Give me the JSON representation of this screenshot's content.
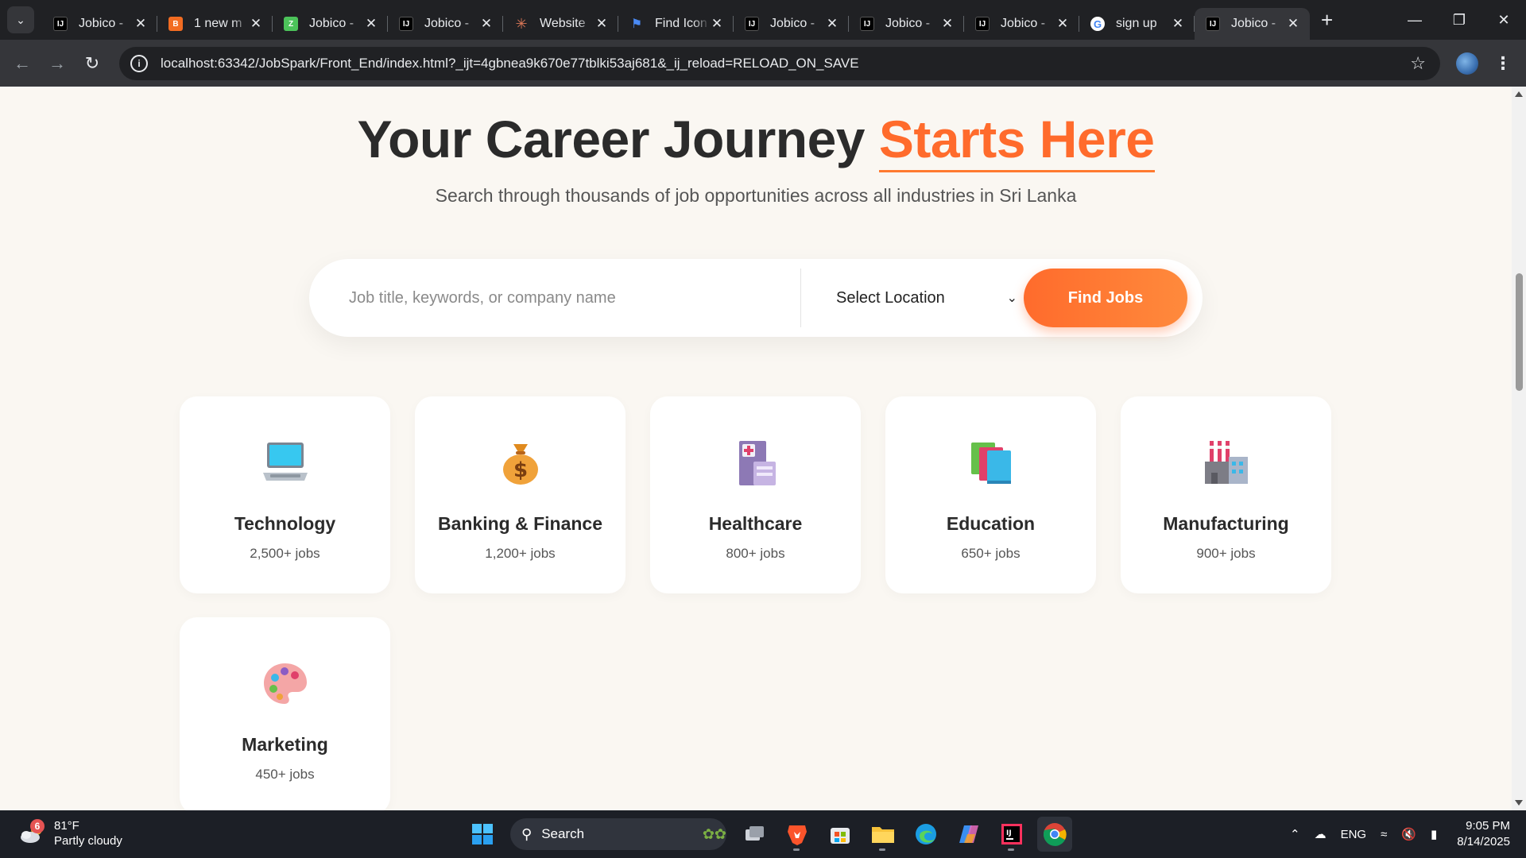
{
  "browser": {
    "tabs": [
      {
        "title": "Jobico -",
        "icon": "intellij-icon",
        "active": false
      },
      {
        "title": "1 new m",
        "icon": "blogger-icon",
        "active": false
      },
      {
        "title": "Jobico -",
        "icon": "green-app-icon",
        "active": false
      },
      {
        "title": "Jobico -",
        "icon": "intellij-icon",
        "active": false
      },
      {
        "title": "Website",
        "icon": "claude-icon",
        "active": false
      },
      {
        "title": "Find Icon",
        "icon": "flag-icon",
        "active": false
      },
      {
        "title": "Jobico -",
        "icon": "intellij-icon",
        "active": false
      },
      {
        "title": "Jobico -",
        "icon": "intellij-icon",
        "active": false
      },
      {
        "title": "Jobico -",
        "icon": "intellij-icon",
        "active": false
      },
      {
        "title": "sign up",
        "icon": "google-icon",
        "active": false
      },
      {
        "title": "Jobico -",
        "icon": "intellij-icon",
        "active": true
      }
    ],
    "url": "localhost:63342/JobSpark/Front_End/index.html?_ijt=4gbnea9k670e77tblki53aj681&_ij_reload=RELOAD_ON_SAVE"
  },
  "hero": {
    "title_main": "Your Career Journey",
    "title_accent": "Starts Here",
    "subtitle": "Search through thousands of job opportunities across all industries in Sri Lanka"
  },
  "search": {
    "placeholder": "Job title, keywords, or company name",
    "location_selected": "Select Location",
    "button_label": "Find Jobs"
  },
  "categories": [
    {
      "name": "Technology",
      "count": "2,500+ jobs",
      "icon": "laptop-icon"
    },
    {
      "name": "Banking & Finance",
      "count": "1,200+ jobs",
      "icon": "money-bag-icon"
    },
    {
      "name": "Healthcare",
      "count": "800+ jobs",
      "icon": "hospital-icon"
    },
    {
      "name": "Education",
      "count": "650+ jobs",
      "icon": "books-icon"
    },
    {
      "name": "Manufacturing",
      "count": "900+ jobs",
      "icon": "factory-icon"
    },
    {
      "name": "Marketing",
      "count": "450+ jobs",
      "icon": "palette-icon"
    }
  ],
  "taskbar": {
    "weather_temp": "81°F",
    "weather_desc": "Partly cloudy",
    "weather_badge": "6",
    "search_label": "Search",
    "language": "ENG",
    "time": "9:05 PM",
    "date": "8/14/2025"
  },
  "colors": {
    "accent": "#ff6b2c",
    "page_bg": "#faf7f2"
  }
}
